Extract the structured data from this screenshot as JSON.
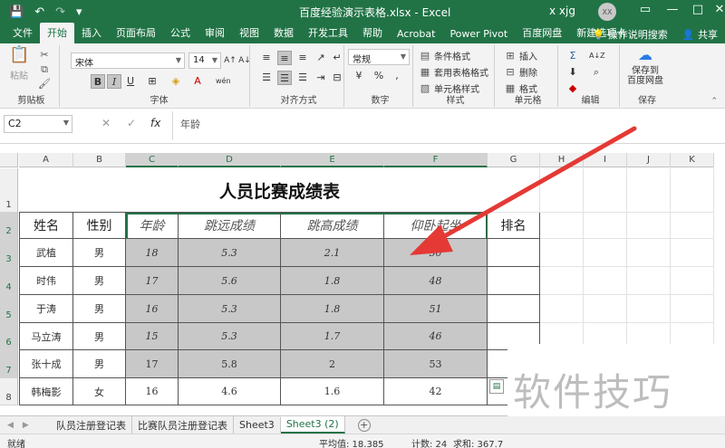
{
  "window": {
    "title": "百度经验演示表格.xlsx - Excel",
    "user": "x xjg",
    "avatar_initials": "XX",
    "minimize": "—",
    "restore": "□",
    "close": "✕",
    "ribbon_toggle": "▭"
  },
  "quick_access": {
    "save": "💾",
    "undo": "↶",
    "redo": "↷",
    "customize": "▾"
  },
  "ribbon_tabs": [
    "文件",
    "开始",
    "插入",
    "页面布局",
    "公式",
    "审阅",
    "视图",
    "数据",
    "开发工具",
    "帮助",
    "Acrobat",
    "Power Pivot",
    "百度网盘",
    "新建选项卡"
  ],
  "tell_me": "操作说明搜索",
  "share": "共享",
  "ribbon": {
    "clipboard": {
      "label": "剪贴板",
      "paste": "粘贴"
    },
    "font": {
      "label": "字体",
      "name": "宋体",
      "size": "14",
      "bold": "B",
      "italic": "I",
      "underline": "U",
      "grow": "A↑",
      "shrink": "A↓",
      "phonetic": "wén"
    },
    "alignment": {
      "label": "对齐方式"
    },
    "number": {
      "label": "数字",
      "format": "常规",
      "percent": "%",
      "comma": ","
    },
    "styles": {
      "label": "样式",
      "conditional": "条件格式",
      "table": "套用表格格式",
      "cell_styles": "单元格样式"
    },
    "cells": {
      "label": "单元格",
      "insert": "插入",
      "delete": "删除",
      "format": "格式"
    },
    "editing": {
      "label": "编辑",
      "sum": "Σ",
      "sort": "A↓Z",
      "find": "⌕"
    },
    "save": {
      "label": "保存",
      "button": "保存到\n百度网盘"
    }
  },
  "formula_bar": {
    "name_box": "C2",
    "cancel": "✕",
    "enter": "✓",
    "fx": "fx",
    "content": "年龄"
  },
  "columns": [
    "A",
    "B",
    "C",
    "D",
    "E",
    "F",
    "G",
    "H",
    "I",
    "J",
    "K"
  ],
  "rows": [
    "1",
    "2",
    "3",
    "4",
    "5",
    "6",
    "7",
    "8"
  ],
  "sheet_title": "人员比赛成绩表",
  "table": {
    "headers": [
      "姓名",
      "性别",
      "年龄",
      "跳远成绩",
      "跳高成绩",
      "仰卧起坐",
      "排名"
    ],
    "rows": [
      [
        "武植",
        "男",
        "18",
        "5.3",
        "2.1",
        "50",
        ""
      ],
      [
        "时伟",
        "男",
        "17",
        "5.6",
        "1.8",
        "48",
        ""
      ],
      [
        "于涛",
        "男",
        "16",
        "5.3",
        "1.8",
        "51",
        ""
      ],
      [
        "马立涛",
        "男",
        "15",
        "5.3",
        "1.7",
        "46",
        ""
      ],
      [
        "张十成",
        "男",
        "17",
        "5.8",
        "2",
        "53",
        ""
      ],
      [
        "韩梅影",
        "女",
        "16",
        "4.6",
        "1.6",
        "42",
        ""
      ]
    ]
  },
  "sheet_tabs": [
    "队员注册登记表",
    "比赛队员注册登记表",
    "Sheet3",
    "Sheet3 (2)"
  ],
  "active_sheet": "Sheet3 (2)",
  "add_sheet": "+",
  "sheet_nav": {
    "prev": "◀",
    "next": "▶"
  },
  "status": {
    "mode": "就绪",
    "average": "平均值: 18.385",
    "count": "计数: 24",
    "sum": "求和: 367.7"
  },
  "watermark": "软件技巧",
  "colors": {
    "excel_green": "#217346",
    "selection_gray": "#c8c8c8",
    "arrow_red": "#e53935"
  }
}
